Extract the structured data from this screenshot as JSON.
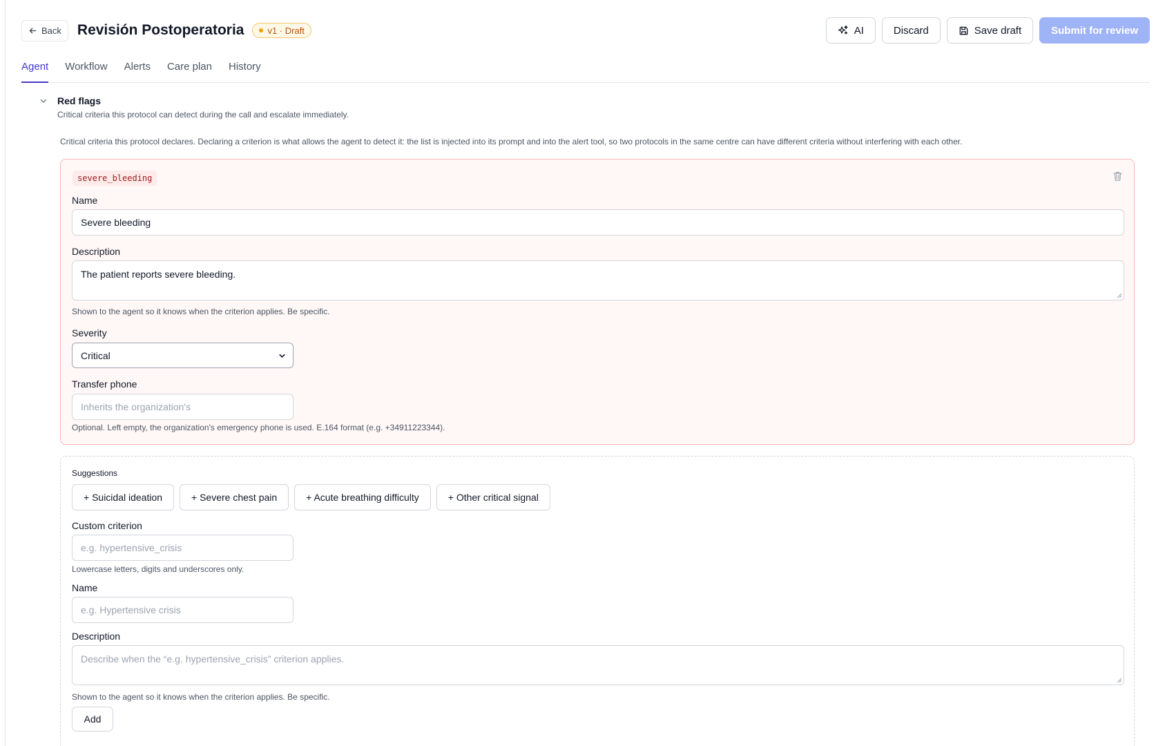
{
  "header": {
    "back_label": "Back",
    "title": "Revisión Postoperatoria",
    "badge": "v1 · Draft",
    "ai_label": "AI",
    "discard_label": "Discard",
    "save_label": "Save draft",
    "submit_label": "Submit for review"
  },
  "tabs": [
    {
      "label": "Agent",
      "active": true
    },
    {
      "label": "Workflow"
    },
    {
      "label": "Alerts"
    },
    {
      "label": "Care plan"
    },
    {
      "label": "History"
    }
  ],
  "section": {
    "title": "Red flags",
    "subtitle": "Critical criteria this protocol can detect during the call and escalate immediately.",
    "description": "Critical criteria this protocol declares. Declaring a criterion is what allows the agent to detect it: the list is injected into its prompt and into the alert tool, so two protocols in the same centre can have different criteria without interfering with each other."
  },
  "criterion": {
    "code": "severe_bleeding",
    "name_label": "Name",
    "name_value": "Severe bleeding",
    "description_label": "Description",
    "description_value": "The patient reports severe bleeding.",
    "description_help": "Shown to the agent so it knows when the criterion applies. Be specific.",
    "severity_label": "Severity",
    "severity_value": "Critical",
    "transfer_label": "Transfer phone",
    "transfer_placeholder": "Inherits the organization's",
    "transfer_help": "Optional. Left empty, the organization's emergency phone is used. E.164 format (e.g. +34911223344)."
  },
  "suggestions": {
    "title": "Suggestions",
    "chips": [
      "+ Suicidal ideation",
      "+ Severe chest pain",
      "+ Acute breathing difficulty",
      "+ Other critical signal"
    ],
    "custom_label": "Custom criterion",
    "custom_placeholder": "e.g. hypertensive_crisis",
    "custom_help": "Lowercase letters, digits and underscores only.",
    "name_label": "Name",
    "name_placeholder": "e.g. Hypertensive crisis",
    "description_label": "Description",
    "description_placeholder": "Describe when the “e.g. hypertensive_crisis” criterion applies.",
    "description_help": "Shown to the agent so it knows when the criterion applies. Be specific.",
    "add_label": "Add"
  },
  "colors": {
    "accent": "#4338ca",
    "submit_bg": "#9fb3f7",
    "card_border": "#f7b4b4",
    "card_bg": "#fff8f7",
    "badge_text": "#b45309"
  }
}
